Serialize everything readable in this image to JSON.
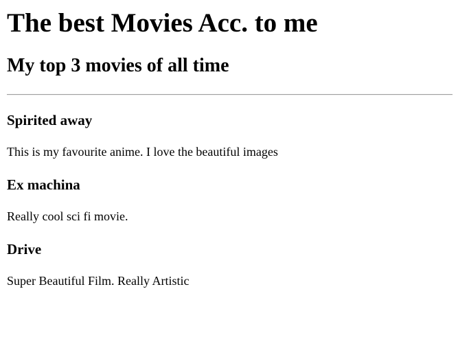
{
  "page": {
    "title": "The best Movies Acc. to me",
    "subtitle": "My top 3 movies of all time"
  },
  "movies": [
    {
      "title": "Spirited away",
      "description": "This is my favourite anime. I love the beautiful images"
    },
    {
      "title": "Ex machina",
      "description": "Really cool sci fi movie."
    },
    {
      "title": "Drive",
      "description": "Super Beautiful Film. Really Artistic"
    }
  ]
}
